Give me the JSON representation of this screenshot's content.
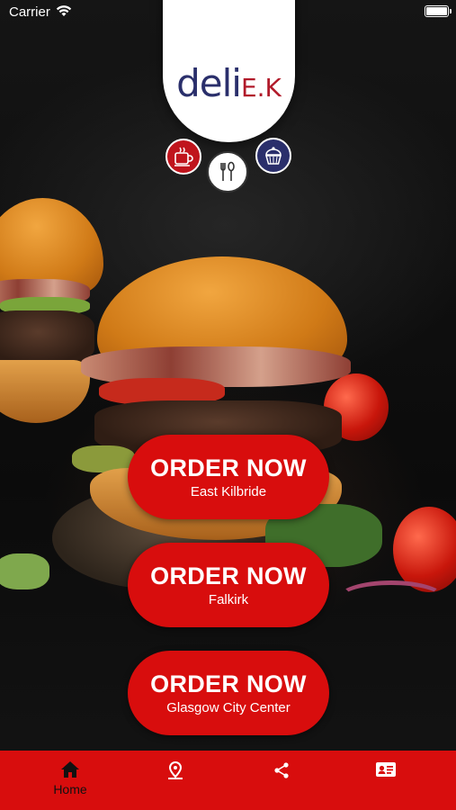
{
  "status_bar": {
    "carrier": "Carrier"
  },
  "logo": {
    "main": "deli",
    "suffix": "E.K"
  },
  "categories": [
    {
      "name": "coffee-cup-icon"
    },
    {
      "name": "fork-spoon-icon"
    },
    {
      "name": "cupcake-icon"
    }
  ],
  "orders": [
    {
      "title": "ORDER NOW",
      "location": "East Kilbride"
    },
    {
      "title": "ORDER NOW",
      "location": "Falkirk"
    },
    {
      "title": "ORDER NOW",
      "location": "Glasgow City Center"
    }
  ],
  "tab_bar": {
    "items": [
      {
        "icon": "home-icon",
        "label": "Home"
      },
      {
        "icon": "location-pin-icon",
        "label": ""
      },
      {
        "icon": "share-icon",
        "label": ""
      },
      {
        "icon": "contact-card-icon",
        "label": ""
      }
    ]
  },
  "colors": {
    "brand_red": "#d80d0d",
    "brand_navy": "#2a2f6b",
    "logo_red": "#b11a2a"
  }
}
